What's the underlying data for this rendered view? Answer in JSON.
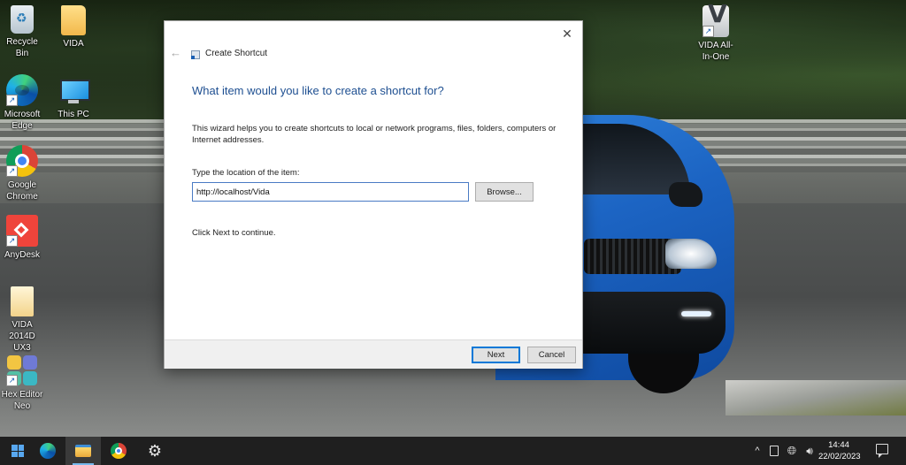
{
  "desktop": {
    "icons": [
      {
        "label": "Recycle Bin",
        "icon": "recycle-bin-icon"
      },
      {
        "label": "VIDA",
        "icon": "user-folder-icon"
      },
      {
        "label": "Microsoft Edge",
        "icon": "edge-icon"
      },
      {
        "label": "This PC",
        "icon": "computer-icon"
      },
      {
        "label": "Google Chrome",
        "icon": "chrome-icon"
      },
      {
        "label": "AnyDesk",
        "icon": "anydesk-icon"
      },
      {
        "label": "VIDA 2014D UX3",
        "icon": "document-folder-icon"
      },
      {
        "label": "Hex Editor Neo",
        "icon": "hex-editor-icon"
      },
      {
        "label": "VIDA All-In-One",
        "icon": "vida-app-icon"
      }
    ]
  },
  "dialog": {
    "back_glyph": "←",
    "close_glyph": "✕",
    "title": "Create Shortcut",
    "heading": "What item would you like to create a shortcut for?",
    "description": "This wizard helps you to create shortcuts to local or network programs, files, folders, computers or Internet addresses.",
    "location_label": "Type the location of the item:",
    "location_value": "http://localhost/Vida",
    "browse_label": "Browse...",
    "continue_text": "Click Next to continue.",
    "next_label": "Next",
    "cancel_label": "Cancel"
  },
  "taskbar": {
    "tray_chevron": "^",
    "clock_time": "14:44",
    "clock_date": "22/02/2023"
  },
  "colors": {
    "heading": "#1e4f91",
    "taskbar": "#1f1f1f",
    "accent": "#0078d7"
  }
}
